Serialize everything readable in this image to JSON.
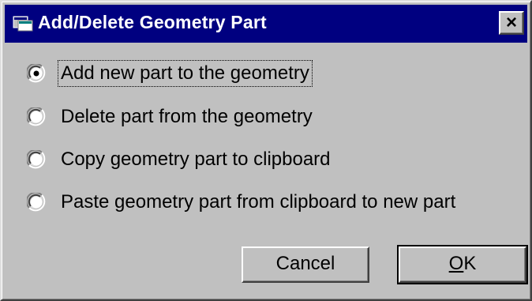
{
  "dialog": {
    "title": "Add/Delete Geometry Part",
    "close_glyph": "✕",
    "icon": "app-window-icon"
  },
  "options": [
    {
      "label": "Add new part to the geometry",
      "selected": true
    },
    {
      "label": "Delete part from the geometry",
      "selected": false
    },
    {
      "label": "Copy geometry part to clipboard",
      "selected": false
    },
    {
      "label": "Paste geometry part from clipboard to new part",
      "selected": false
    }
  ],
  "buttons": {
    "cancel_label": "Cancel",
    "ok_label_mnemonic": "O",
    "ok_label_rest": "K"
  },
  "colors": {
    "titlebar": "#000080",
    "face": "#c0c0c0"
  }
}
